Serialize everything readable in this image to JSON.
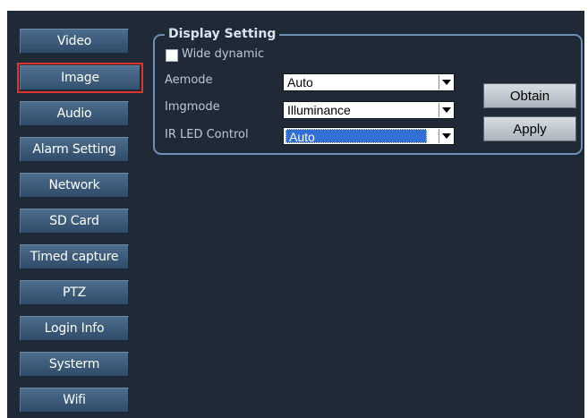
{
  "sidebar": {
    "items": [
      {
        "label": "Video"
      },
      {
        "label": "Image",
        "selected": true
      },
      {
        "label": "Audio"
      },
      {
        "label": "Alarm Setting"
      },
      {
        "label": "Network"
      },
      {
        "label": "SD Card"
      },
      {
        "label": "Timed capture"
      },
      {
        "label": "PTZ"
      },
      {
        "label": "Login Info"
      },
      {
        "label": "Systerm"
      },
      {
        "label": "Wifi"
      }
    ]
  },
  "display_setting": {
    "title": "Display Setting",
    "wide_dynamic": {
      "label": "Wide dynamic",
      "checked": false
    },
    "aemode": {
      "label": "Aemode",
      "value": "Auto"
    },
    "imgmode": {
      "label": "Imgmode",
      "value": "Illuminance"
    },
    "ir_led_control": {
      "label": "IR LED Control",
      "value": "Auto"
    },
    "obtain_label": "Obtain",
    "apply_label": "Apply"
  },
  "colors": {
    "background": "#1f2a36",
    "selection_outline": "#e0332b",
    "group_border": "#6d8fb3"
  }
}
